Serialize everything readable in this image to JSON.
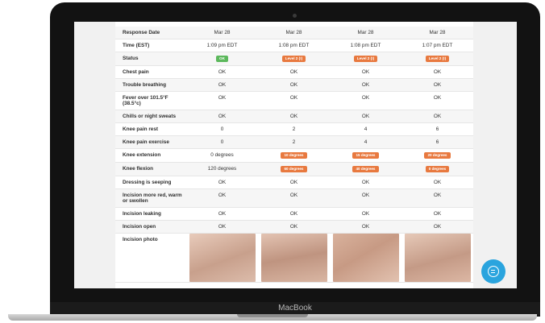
{
  "device": {
    "brand": "MacBook"
  },
  "table": {
    "rows": [
      {
        "label": "Response Date",
        "values": [
          "Mar 28",
          "Mar 28",
          "Mar 28",
          "Mar 28"
        ],
        "kind": "text"
      },
      {
        "label": "Time (EST)",
        "values": [
          "1:09 pm EDT",
          "1:08 pm EDT",
          "1:08 pm EDT",
          "1:07 pm EDT"
        ],
        "kind": "text"
      },
      {
        "label": "Status",
        "values": [
          "OK",
          "Level 2 (!)",
          "Level 2 (!)",
          "Level 2 (!)"
        ],
        "kind": "badge",
        "colors": [
          "green",
          "orange",
          "orange",
          "orange"
        ]
      },
      {
        "label": "Chest pain",
        "values": [
          "OK",
          "OK",
          "OK",
          "OK"
        ],
        "kind": "text"
      },
      {
        "label": "Trouble breathing",
        "values": [
          "OK",
          "OK",
          "OK",
          "OK"
        ],
        "kind": "text"
      },
      {
        "label": "Fever over 101.5°F (38.5°c)",
        "values": [
          "OK",
          "OK",
          "OK",
          "OK"
        ],
        "kind": "text"
      },
      {
        "label": "Chills or night sweats",
        "values": [
          "OK",
          "OK",
          "OK",
          "OK"
        ],
        "kind": "text"
      },
      {
        "label": "Knee pain rest",
        "values": [
          "0",
          "2",
          "4",
          "6"
        ],
        "kind": "text"
      },
      {
        "label": "Knee pain exercise",
        "values": [
          "0",
          "2",
          "4",
          "6"
        ],
        "kind": "text"
      },
      {
        "label": "Knee extension",
        "values": [
          "0 degrees",
          "10 degrees",
          "15 degrees",
          "20 degrees"
        ],
        "kind": "mixed",
        "colors": [
          "none",
          "orange",
          "orange",
          "orange"
        ]
      },
      {
        "label": "Knee flexion",
        "values": [
          "120 degrees",
          "60 degrees",
          "40 degrees",
          "0 degrees"
        ],
        "kind": "mixed",
        "colors": [
          "none",
          "orange",
          "orange",
          "orange"
        ]
      },
      {
        "label": "Dressing is seeping",
        "values": [
          "OK",
          "OK",
          "OK",
          "OK"
        ],
        "kind": "text"
      },
      {
        "label": "Incision more red, warm or swollen",
        "values": [
          "OK",
          "OK",
          "OK",
          "OK"
        ],
        "kind": "text"
      },
      {
        "label": "Incision leaking",
        "values": [
          "OK",
          "OK",
          "OK",
          "OK"
        ],
        "kind": "text"
      },
      {
        "label": "Incision open",
        "values": [
          "OK",
          "OK",
          "OK",
          "OK"
        ],
        "kind": "text"
      },
      {
        "label": "Incision photo",
        "values": [
          "",
          "",
          "",
          ""
        ],
        "kind": "photo"
      }
    ]
  },
  "colors": {
    "ok_badge": "#5cb85c",
    "alert_badge": "#e8793f",
    "chat_button": "#2aa4de"
  },
  "chat": {
    "icon": "chat-bubble-icon"
  }
}
